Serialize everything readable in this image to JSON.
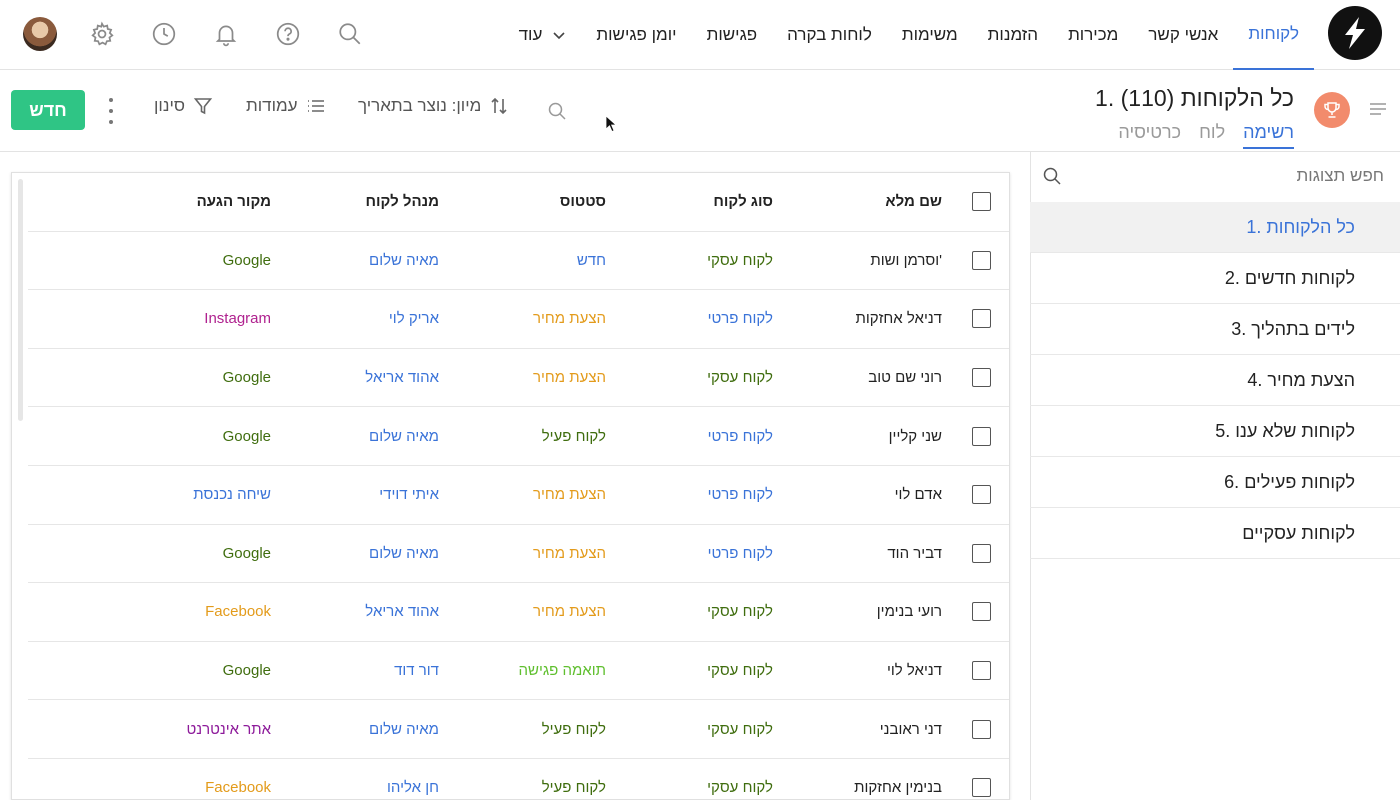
{
  "nav": {
    "items": [
      "לקוחות",
      "אנשי קשר",
      "מכירות",
      "הזמנות",
      "משימות",
      "לוחות בקרה",
      "פגישות",
      "יומן פגישות"
    ],
    "more_label": "עוד"
  },
  "subheader": {
    "title": "1. כל הלקוחות  (110)",
    "tabs": [
      "רשימה",
      "לוח",
      "כרטיסיה"
    ],
    "sort_label": "מיון: נוצר בתאריך",
    "columns_label": "עמודות",
    "filter_label": "סינון",
    "new_label": "חדש"
  },
  "side": {
    "search_placeholder": "חפש תצוגות",
    "items": [
      "1. כל הלקוחות",
      "2. לקוחות חדשים",
      "3. לידים בתהליך",
      "4. הצעת מחיר",
      "5. לקוחות שלא ענו",
      "6. לקוחות פעילים",
      "לקוחות עסקיים"
    ]
  },
  "table": {
    "headers": {
      "name": "שם מלא",
      "type": "סוג לקוח",
      "status": "סטטוס",
      "manager": "מנהל לקוח",
      "source": "מקור הגעה"
    },
    "rows": [
      {
        "name": "וסרמן ושות'",
        "type": "לקוח עסקי",
        "status": "חדש",
        "manager": "מאיה שלום",
        "source": "Google"
      },
      {
        "name": "דניאל אחזקות",
        "type": "לקוח פרטי",
        "status": "הצעת מחיר",
        "manager": "אריק לוי",
        "source": "Instagram"
      },
      {
        "name": "רוני שם טוב",
        "type": "לקוח עסקי",
        "status": "הצעת מחיר",
        "manager": "אהוד אריאל",
        "source": "Google"
      },
      {
        "name": "שני קליין",
        "type": "לקוח פרטי",
        "status": "לקוח פעיל",
        "manager": "מאיה שלום",
        "source": "Google"
      },
      {
        "name": "אדם לוי",
        "type": "לקוח פרטי",
        "status": "הצעת מחיר",
        "manager": "איתי דוידי",
        "source": "שיחה נכנסת"
      },
      {
        "name": "דביר הוד",
        "type": "לקוח פרטי",
        "status": "הצעת מחיר",
        "manager": "מאיה שלום",
        "source": "Google"
      },
      {
        "name": "רועי בנימין",
        "type": "לקוח עסקי",
        "status": "הצעת מחיר",
        "manager": "אהוד אריאל",
        "source": "Facebook"
      },
      {
        "name": "דניאל לוי",
        "type": "לקוח עסקי",
        "status": "תואמה פגישה",
        "manager": "דור דוד",
        "source": "Google"
      },
      {
        "name": "דני ראובני",
        "type": "לקוח עסקי",
        "status": "לקוח פעיל",
        "manager": "מאיה שלום",
        "source": "אתר אינטרנט"
      },
      {
        "name": "בנימין אחזקות",
        "type": "לקוח עסקי",
        "status": "לקוח פעיל",
        "manager": "חן אליהו",
        "source": "Facebook"
      }
    ]
  },
  "colors": {
    "accent": "#3a73d8",
    "new_button": "#2fc585",
    "type": {
      "לקוח עסקי": "#3f6d0e",
      "לקוח פרטי": "#3a73d8"
    },
    "status": {
      "חדש": "#3a73d8",
      "הצעת מחיר": "#e39b1b",
      "לקוח פעיל": "#3f6d0e",
      "תואמה פגישה": "#5fbf2e"
    },
    "manager": "#3a73d8",
    "source": {
      "Google": "#3f6d0e",
      "Instagram": "#b0228f",
      "שיחה נכנסת": "#3a73d8",
      "Facebook": "#e39b1b",
      "אתר אינטרנט": "#8d1a9a"
    }
  },
  "icons": [
    "logo-icon",
    "settings-icon",
    "history-icon",
    "bell-icon",
    "help-icon",
    "search-icon",
    "chevron-down-icon",
    "trophy-icon",
    "sort-icon",
    "columns-icon",
    "filter-icon",
    "kebab-icon",
    "hamburger-icon"
  ]
}
